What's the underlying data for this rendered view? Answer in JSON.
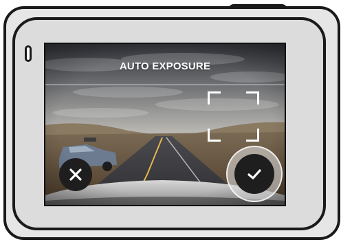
{
  "screen": {
    "title": "AUTO EXPOSURE"
  },
  "icons": {
    "cancel": "close-icon",
    "confirm": "checkmark-icon",
    "focus": "exposure-target-brackets",
    "led": "status-led"
  },
  "colors": {
    "overlay_text": "#ffffff",
    "button_fill": "#1e1e1e",
    "camera_outline": "#1a1a1a",
    "camera_body": "#e6e6e6"
  }
}
